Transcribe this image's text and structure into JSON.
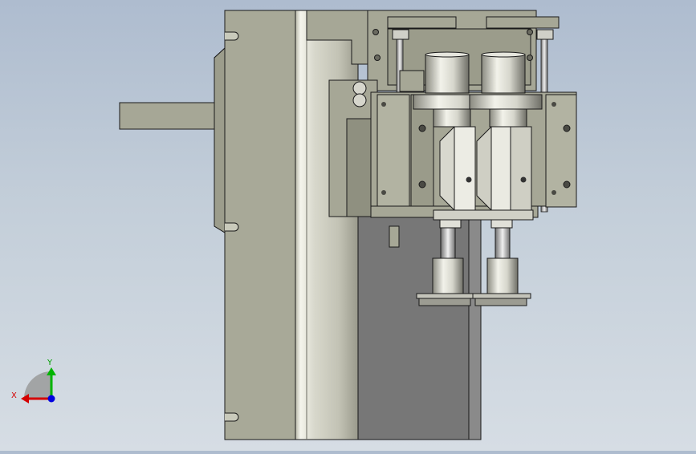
{
  "viewport": {
    "background_top": "#aebccf",
    "background_bottom": "#d6dde4"
  },
  "triad": {
    "x_label": "X",
    "y_label": "Y",
    "x_color": "#d40000",
    "y_color": "#00b400",
    "z_color": "#0000e0"
  },
  "model": {
    "colors": {
      "body": "#a6a796",
      "edge": "#1a1a1a",
      "metal_light": "#e8e8e0",
      "metal_dark": "#7c7c72",
      "block": "#909080",
      "shadow": "#767676"
    }
  }
}
